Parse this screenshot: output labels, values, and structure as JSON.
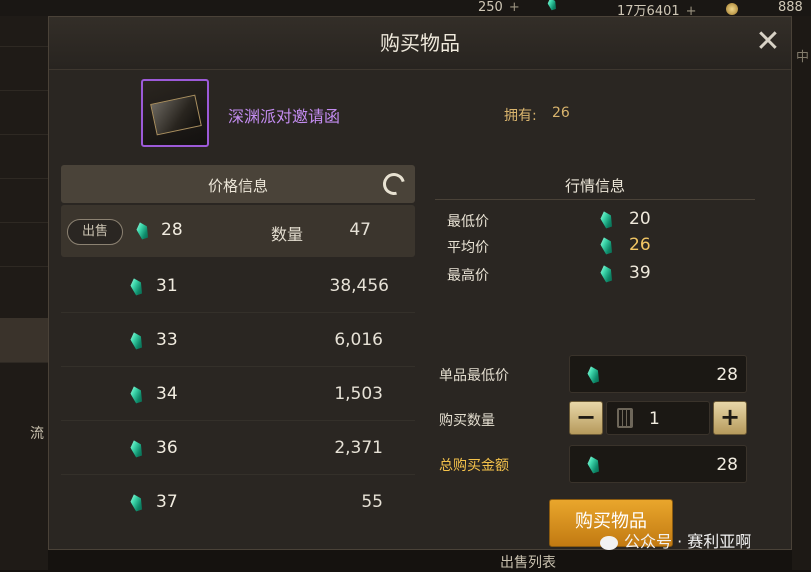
{
  "hud": {
    "left_value": "250",
    "right_value": "17万6401",
    "far_right": "888"
  },
  "sidebar": {
    "tab_label": "流"
  },
  "right_edge": {
    "label": "中"
  },
  "dialog": {
    "title": "购买物品",
    "item": {
      "name": "深渊派对邀请函",
      "owned_label": "拥有:",
      "owned_value": "26"
    },
    "price_info": {
      "title": "价格信息",
      "sell_badge": "出售",
      "qty_label": "数量",
      "listings": [
        {
          "price": "28",
          "qty": "47"
        },
        {
          "price": "31",
          "qty": "38,456"
        },
        {
          "price": "33",
          "qty": "6,016"
        },
        {
          "price": "34",
          "qty": "1,503"
        },
        {
          "price": "36",
          "qty": "2,371"
        },
        {
          "price": "37",
          "qty": "55"
        }
      ]
    },
    "market": {
      "title": "行情信息",
      "min_label": "最低价",
      "min_value": "20",
      "avg_label": "平均价",
      "avg_value": "26",
      "max_label": "最高价",
      "max_value": "39"
    },
    "form": {
      "unit_min_label": "单品最低价",
      "unit_min_value": "28",
      "qty_label": "购买数量",
      "qty_value": "1",
      "total_label": "总购买金额",
      "total_value": "28",
      "buy_button": "购买物品"
    }
  },
  "footer": {
    "sale_list": "出售列表",
    "watermark": "公众号 · 赛利亚啊"
  },
  "colors": {
    "item_name": "#c38cf0",
    "gold_text": "#f4c24b",
    "buy_button": "#e9a62c"
  },
  "icons": [
    "gem-icon",
    "refresh-icon",
    "close-icon",
    "calculator-icon",
    "gold-coin-icon"
  ]
}
